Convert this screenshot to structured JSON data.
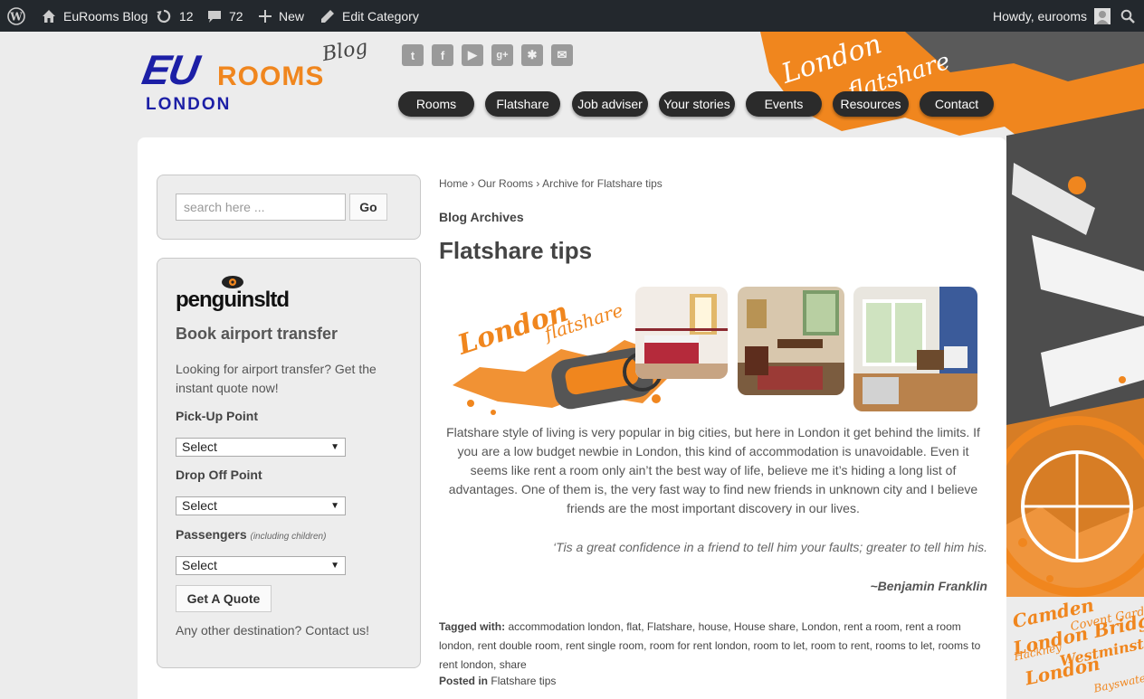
{
  "admin_bar": {
    "site_name": "EuRooms Blog",
    "updates_count": "12",
    "comments_count": "72",
    "new_label": "New",
    "edit_label": "Edit Category",
    "greeting": "Howdy, eurooms"
  },
  "logo": {
    "eu": "EU",
    "rooms": "ROOMS",
    "blog": "Blog",
    "city": "LONDON"
  },
  "social_icons": [
    "twitter-icon",
    "facebook-icon",
    "youtube-icon",
    "google-plus-icon",
    "yelp-icon",
    "email-icon"
  ],
  "nav": {
    "items": [
      "Rooms",
      "Flatshare",
      "Job adviser",
      "Your stories",
      "Events",
      "Resources",
      "Contact"
    ]
  },
  "sidebar": {
    "search": {
      "placeholder": "search here ...",
      "button": "Go"
    },
    "transfer": {
      "brand": "penguinsltd",
      "title": "Book airport transfer",
      "intro": "Looking for airport transfer? Get the instant quote now!",
      "pickup_label": "Pick-Up Point",
      "pickup_value": "Select",
      "dropoff_label": "Drop Off Point",
      "dropoff_value": "Select",
      "passengers_label": "Passengers",
      "passengers_note": "(including children)",
      "passengers_value": "Select",
      "quote_button": "Get A Quote",
      "other": "Any other destination? Contact us!"
    }
  },
  "main": {
    "breadcrumb": {
      "home": "Home",
      "sep": "›",
      "rooms": "Our Rooms",
      "current": "Archive for Flatshare tips"
    },
    "archive_label": "Blog Archives",
    "title": "Flatshare tips",
    "banner": {
      "line1": "London",
      "line2": "flatshare"
    },
    "body": "Flatshare style of living is very popular in big cities, but here in London it get behind the limits. If you are a low budget newbie in London, this kind of accommodation is unavoidable. Even it seems like rent a room only ain’t the best way of life, believe me it’s hiding a long list of advantages. One of them is, the very fast way to find new friends in unknown city and I believe friends are the most important discovery in our lives.",
    "quote": "‘Tis a great confidence in a friend to tell him your faults; greater to tell him his.",
    "quote_author": "~Benjamin Franklin",
    "tagged_label": "Tagged with:",
    "tags": "accommodation london, flat, Flatshare, house, House share, London, rent a room, rent a room london, rent double room, rent single room, room for rent london, room to let, room to rent, rooms to let, rooms to rent london, share",
    "posted_label": "Posted in",
    "posted_category": "Flatshare tips"
  },
  "background": {
    "top_text1": "London",
    "top_text2": "flatshare",
    "bottom_words": [
      "Camden",
      "London Bridge",
      "Covent Garden",
      "Hackney",
      "Westminster",
      "London",
      "Bayswater"
    ]
  },
  "colors": {
    "accent_orange": "#f0861e",
    "logo_blue": "#1c1fa6",
    "admin_bar": "#23282d"
  }
}
